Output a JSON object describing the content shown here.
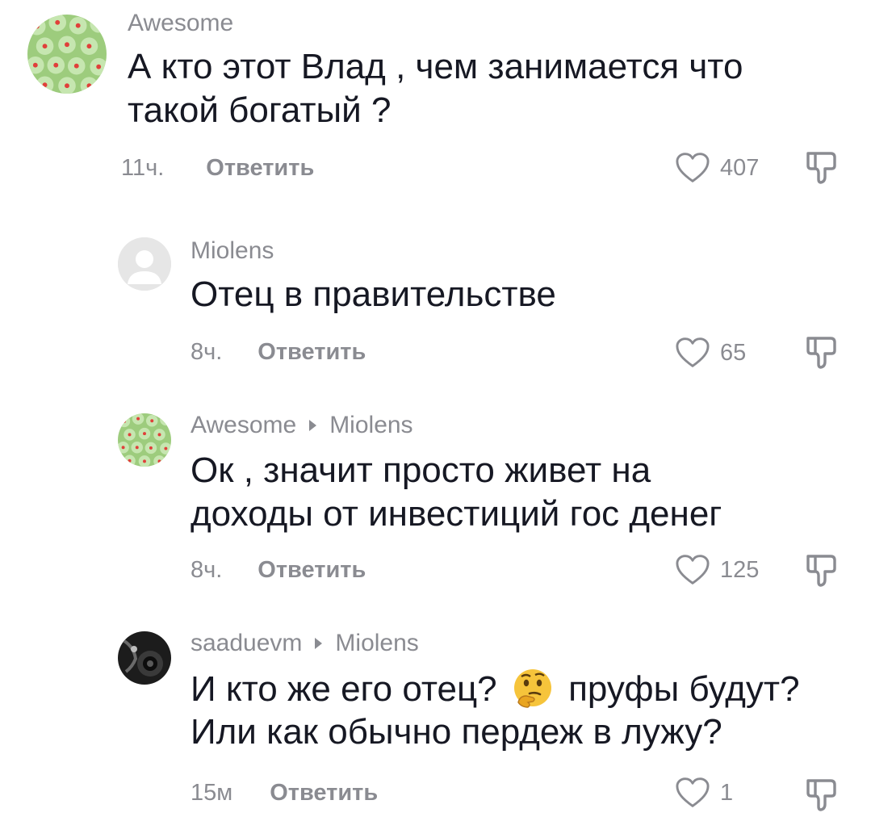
{
  "comments": [
    {
      "author": "Awesome",
      "reply_to": "",
      "lines": [
        "А кто этот Влад , чем занимается что",
        "такой богатый ?"
      ],
      "time": "11ч.",
      "reply_label": "Ответить",
      "likes": "407",
      "avatar_icon": "green-pattern-avatar"
    },
    {
      "author": "Miolens",
      "reply_to": "",
      "lines": [
        "Отец в правительстве"
      ],
      "time": "8ч.",
      "reply_label": "Ответить",
      "likes": "65",
      "avatar_icon": "default-user-avatar"
    },
    {
      "author": "Awesome",
      "reply_to": "Miolens",
      "lines": [
        "Ок , значит просто живет на",
        "доходы от инвестиций гос денег"
      ],
      "time": "8ч.",
      "reply_label": "Ответить",
      "likes": "125",
      "avatar_icon": "green-pattern-avatar"
    },
    {
      "author": "saaduevm",
      "reply_to": "Miolens",
      "lines_parts": {
        "line1_before": "И кто же его отец?",
        "emoji": "thinking-face",
        "line1_after": "пруфы будут?",
        "line2": "Или как обычно пердеж в лужу?"
      },
      "time": "15м",
      "reply_label": "Ответить",
      "likes": "1",
      "avatar_icon": "camera-photo-avatar"
    }
  ],
  "icons": {
    "like": "heart-outline-icon",
    "dislike": "thumbs-down-icon",
    "reply_arrow": "triangle-right-icon"
  },
  "colors": {
    "text": "#161823",
    "secondary": "#8a8b91",
    "avatar_green": "#8bc26b"
  }
}
